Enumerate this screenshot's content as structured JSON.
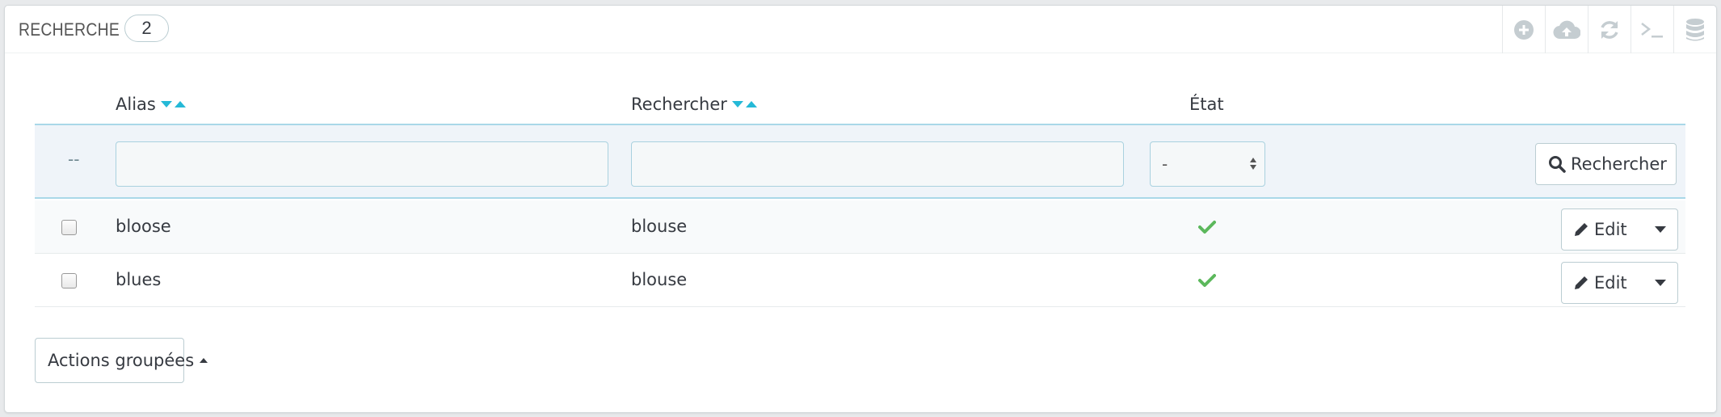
{
  "panel": {
    "title": "RECHERCHE",
    "count": "2"
  },
  "toolbar": {
    "icons": [
      "add-new-icon",
      "cloud-upload-icon",
      "refresh-icon",
      "terminal-icon",
      "database-icon"
    ]
  },
  "table": {
    "columns": {
      "alias": "Alias",
      "search": "Rechercher",
      "state": "État"
    },
    "filter": {
      "dashes": "--",
      "alias_value": "",
      "search_value": "",
      "state_selected": "-",
      "submit_label": "Rechercher"
    },
    "rows": [
      {
        "alias": "bloose",
        "search": "blouse",
        "active": true,
        "edit_label": "Edit"
      },
      {
        "alias": "blues",
        "search": "blouse",
        "active": true,
        "edit_label": "Edit"
      }
    ]
  },
  "bulk_actions": {
    "label": "Actions groupées"
  },
  "colors": {
    "accent": "#25b9d7",
    "success": "#5cb85c",
    "filter_bg": "#eff4f9",
    "text": "#363a41"
  }
}
